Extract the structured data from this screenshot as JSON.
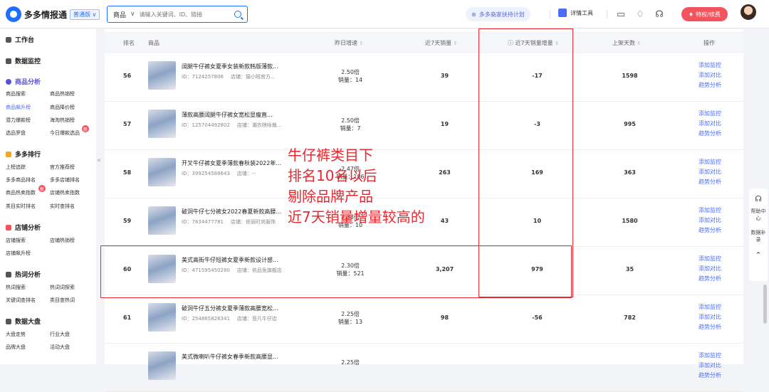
{
  "header": {
    "app_name": "多多情报通",
    "version_badge": "普通版 ∨",
    "search_category": "商品",
    "search_placeholder": "请输入关键词、ID、链接",
    "plan_label": "多多商家扶持计划",
    "detail_tool_label": "详情工具",
    "vip_label": "特权/续费"
  },
  "sidebar": {
    "sections": [
      {
        "label": "工作台",
        "items": []
      },
      {
        "label": "数据监控",
        "items": []
      },
      {
        "label": "商品分析",
        "items": [
          "商品搜索",
          "商品热销榜",
          "商品飙升榜",
          "商品降价榜",
          "潜力爆款榜",
          "海淘热销榜",
          "选品罗盘",
          "今日爆款选品"
        ]
      },
      {
        "label": "多多排行",
        "items": [
          "上榜追踪",
          "官方推荐榜",
          "多多商品排名",
          "多多店铺排名",
          "商品热卖指数",
          "店铺热卖指数",
          "类目实时排名",
          "实时查排名"
        ]
      },
      {
        "label": "店铺分析",
        "items": [
          "店铺搜索",
          "店铺热销榜",
          "店铺飙升榜"
        ]
      },
      {
        "label": "热词分析",
        "items": [
          "热词搜索",
          "热词词探索",
          "关键词查排名",
          "类目查热词"
        ]
      },
      {
        "label": "数据大盘",
        "items": [
          "大盘走势",
          "行业大盘",
          "品牌大盘",
          "活动大盘"
        ]
      }
    ],
    "new_badge": "新"
  },
  "table": {
    "columns": {
      "rank": "排名",
      "product": "商品",
      "growth": "昨日增速",
      "sales7": "近7天销量",
      "increase7": "近7天销量增量",
      "days": "上架天数",
      "ops": "操作"
    },
    "id_prefix": "ID：",
    "shop_prefix": "店铺：",
    "ops": [
      "添加监控",
      "添加对比",
      "趋势分析"
    ],
    "rows": [
      {
        "rank": "56",
        "title": "阔腿牛仔裤女夏季女装新款韩版薄款...",
        "id": "7124257806",
        "shop": "猫小贱官方...",
        "growth": "2.50倍",
        "sales": "销量：14",
        "sales7": "39",
        "increase7": "-17",
        "days": "1598"
      },
      {
        "rank": "57",
        "title": "薄款高腰阔腿牛仔裤女宽松显瘦直...",
        "id": "125704492802",
        "shop": "潮衣映咏裁...",
        "growth": "2.50倍",
        "sales": "销量：7",
        "sales7": "19",
        "increase7": "-3",
        "days": "995"
      },
      {
        "rank": "58",
        "title": "开叉牛仔裤女夏季薄款春秋装2022年...",
        "id": "399254588643",
        "shop": "--",
        "growth": "2.47倍",
        "sales": "销量：186",
        "sales7": "263",
        "increase7": "169",
        "days": "363"
      },
      {
        "rank": "59",
        "title": "破洞牛仔七分裤女2022春夏新款高腰...",
        "id": "7834477781",
        "shop": "依丽时尚服饰",
        "growth": "2.33倍",
        "sales": "销量：10",
        "sales7": "43",
        "increase7": "10",
        "days": "1580"
      },
      {
        "rank": "60",
        "title": "美式高街牛仔短裤女夏季新款设计感...",
        "id": "471595450280",
        "shop": "依品免旗舰店",
        "growth": "2.30倍",
        "sales": "销量：521",
        "sales7": "3,207",
        "increase7": "979",
        "days": "35"
      },
      {
        "rank": "61",
        "title": "破洞牛仔五分裤女夏季薄款高腰宽松...",
        "id": "254865826341",
        "shop": "悲凡牛仔店",
        "growth": "2.25倍",
        "sales": "销量：13",
        "sales7": "98",
        "increase7": "-56",
        "days": "782"
      },
      {
        "rank": "",
        "title": "美式微喇叭牛仔裤女春季新款高腰显...",
        "id": "",
        "shop": "",
        "growth": "2.25倍",
        "sales": "",
        "sales7": "",
        "increase7": "",
        "days": ""
      }
    ]
  },
  "annotation": {
    "lines": [
      "牛仔裤类目下",
      "排名10名以后",
      "剔除品牌产品",
      "近7天销量增量较高的"
    ]
  },
  "right_panel": {
    "help": "帮助中心",
    "supplement": "数据补录"
  }
}
